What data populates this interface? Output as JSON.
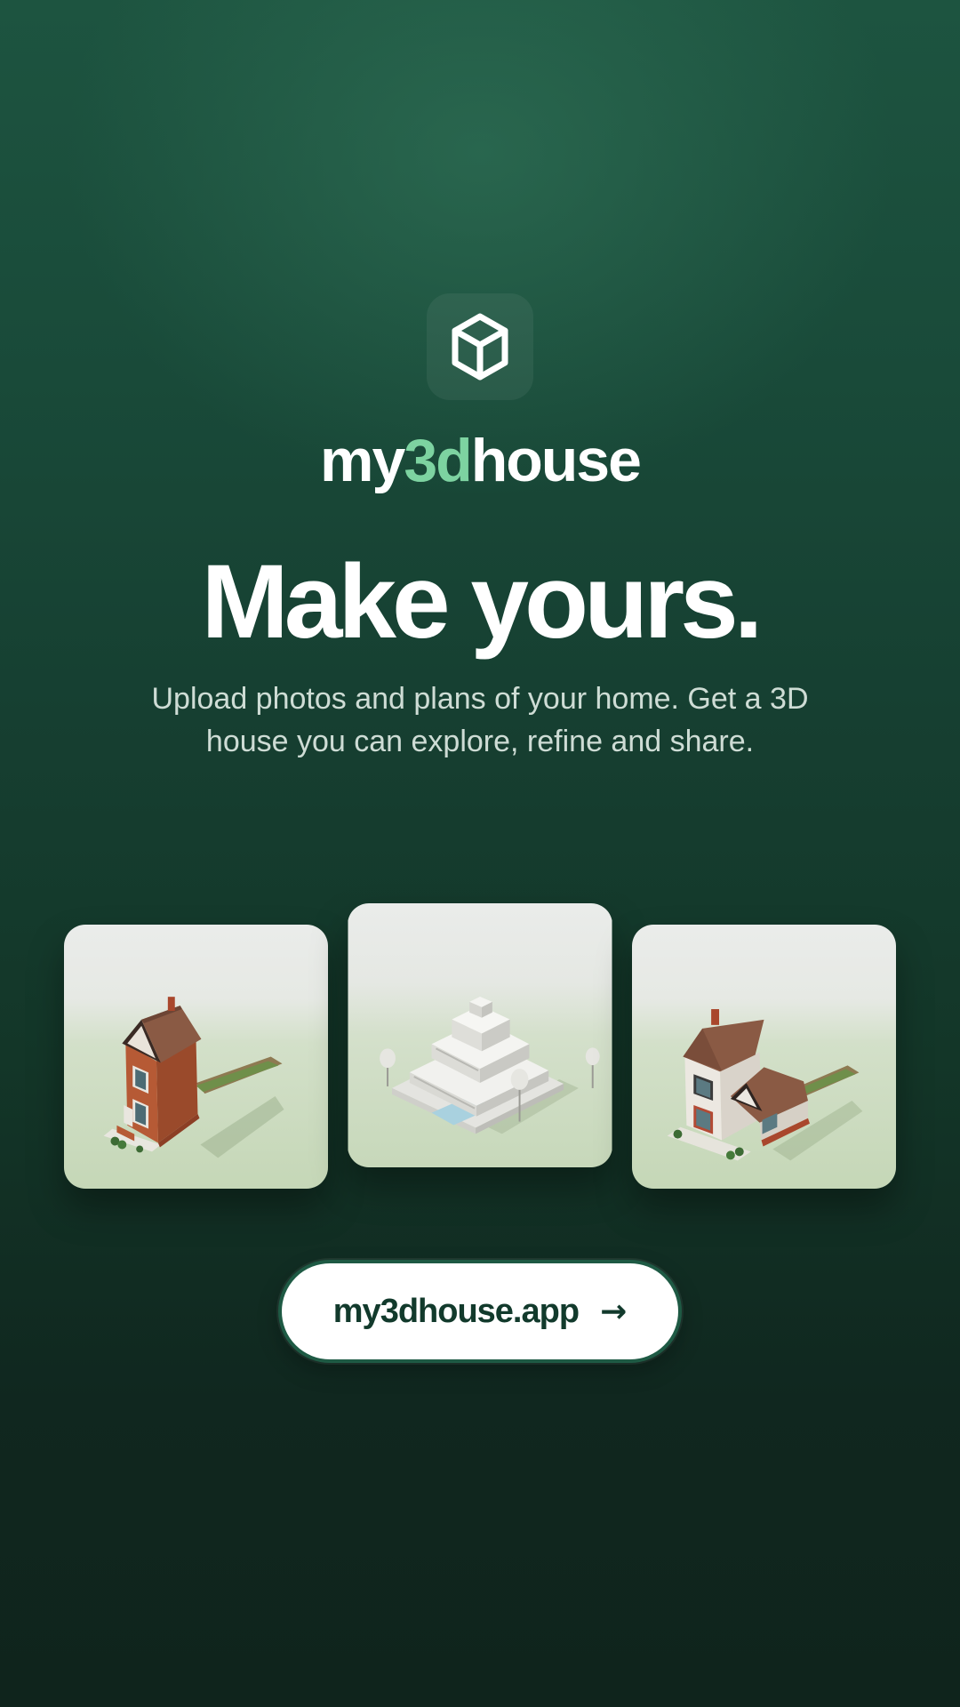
{
  "logo": {
    "icon": "cube-icon"
  },
  "brand": {
    "prefix": "my",
    "accent": "3d",
    "suffix": "house"
  },
  "hero": {
    "headline": "Make yours.",
    "subtitle_line1": "Upload photos and plans of your home. Get a 3D",
    "subtitle_line2": "house you can explore, refine and share."
  },
  "gallery": [
    {
      "name": "brick-terraced-house"
    },
    {
      "name": "modern-white-villa"
    },
    {
      "name": "tudor-detached-house"
    }
  ],
  "cta": {
    "label": "my3dhouse.app",
    "icon": "arrow-right-icon",
    "arrow": "→"
  },
  "colors": {
    "background_top": "#1d5440",
    "background_bottom": "#0f241c",
    "accent": "#7dd3a1",
    "cta_text": "#123a2c",
    "cta_background": "#ffffff"
  }
}
